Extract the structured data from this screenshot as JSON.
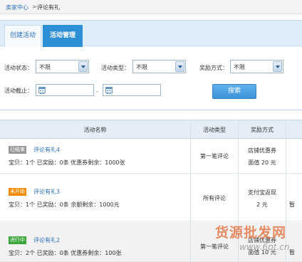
{
  "breadcrumb": {
    "home": "卖家中心",
    "separator": ">",
    "current": "评论有礼"
  },
  "tabs": [
    {
      "label": "创建活动",
      "active": false
    },
    {
      "label": "活动管理",
      "active": true
    }
  ],
  "filters": {
    "status_label": "活动状态：",
    "status_value": "不限",
    "type_label": "活动类型：",
    "type_value": "不限",
    "reward_label": "奖励方式：",
    "reward_value": "不限",
    "deadline_label": "活动截止：",
    "date_separator": "-",
    "search_label": "搜索"
  },
  "table": {
    "headers": [
      "活动名称",
      "活动类型",
      "奖励方式"
    ],
    "rows": [
      {
        "status": "已结束",
        "status_color": "#999999",
        "name": "评论有礼4",
        "meta": "宝贝：1个    已奖励：0条    优惠券剩余：1000张",
        "type": "第一笔评论",
        "reward_line1": "店铺优惠券",
        "reward_line2": "面值 20 元",
        "extra": ""
      },
      {
        "status": "未开始",
        "status_color": "#f08a00",
        "name": "评论有礼3",
        "meta": "宝贝：1个    已奖励：0条    余额剩余：1000元",
        "type": "所有评论",
        "reward_line1": "支付宝返现",
        "reward_line2": "2 元",
        "extra": "暂"
      },
      {
        "status": "进行中",
        "status_color": "#3aa53a",
        "name": "评论有礼2",
        "meta": "宝贝：2个    已奖励：0条    优惠券剩余：100张",
        "type": "第一笔评论",
        "reward_line1": "店铺优惠券",
        "reward_line2": "面值 10 元",
        "extra": "暂"
      }
    ]
  },
  "watermark": {
    "line1": "货源批发网",
    "line2": "www.6pt.cn"
  }
}
